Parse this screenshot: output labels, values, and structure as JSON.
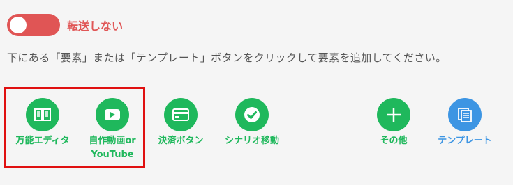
{
  "transfer_toggle": {
    "label": "転送しない",
    "state": "off",
    "color": "#e05555"
  },
  "instruction": "下にある「要素」または「テンプレート」ボタンをクリックして要素を追加してください。",
  "colors": {
    "green": "#1fb85c",
    "blue": "#3d95e3",
    "highlight": "#e01010"
  },
  "buttons": [
    {
      "icon": "book-icon",
      "label": "万能エディタ"
    },
    {
      "icon": "video-play-icon",
      "label_line1": "自作動画or",
      "label_line2": "YouTube"
    },
    {
      "icon": "credit-card-icon",
      "label": "決済ボタン"
    },
    {
      "icon": "check-icon",
      "label": "シナリオ移動"
    },
    {
      "icon": "plus-icon",
      "label": "その他"
    },
    {
      "icon": "template-pages-icon",
      "label": "テンプレート"
    }
  ]
}
